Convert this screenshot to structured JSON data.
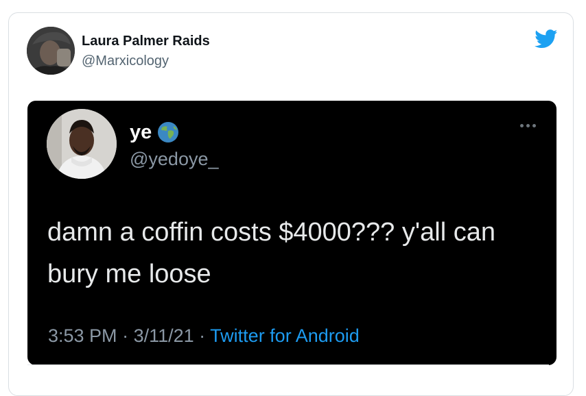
{
  "tweet": {
    "author_name": "Laura Palmer Raids",
    "author_handle": "@Marxicology",
    "logo_icon": "twitter-bird-icon",
    "brand_color": "#1da1f2"
  },
  "quoted": {
    "name": "ye",
    "badge_icon": "globe-emoji-icon",
    "handle": "@yedoye_",
    "text": "damn a coffin costs $4000??? y'all can bury me loose",
    "time": "3:53 PM",
    "separator": " · ",
    "date": "3/11/21",
    "source": "Twitter for Android",
    "more_icon": "more-dots-icon"
  }
}
